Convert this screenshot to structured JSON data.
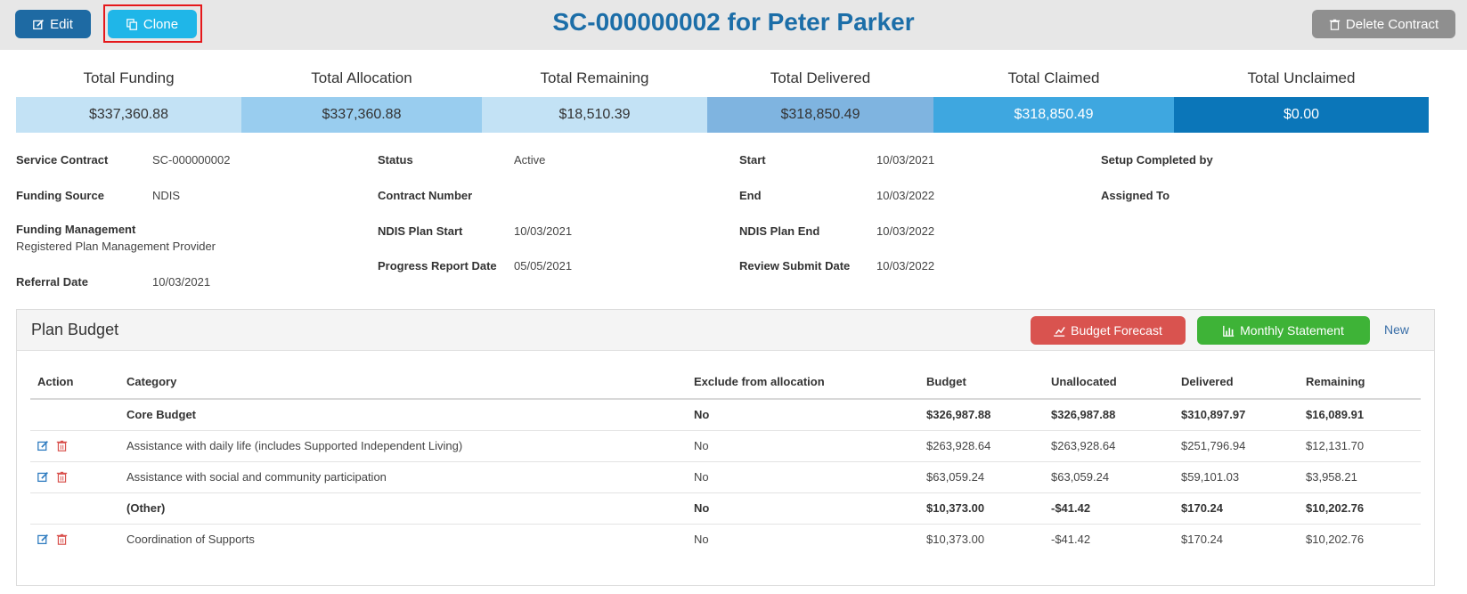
{
  "header": {
    "title": "SC-000000002 for Peter Parker",
    "edit_label": "Edit",
    "clone_label": "Clone",
    "delete_label": "Delete Contract"
  },
  "totals": {
    "labels": [
      "Total Funding",
      "Total Allocation",
      "Total Remaining",
      "Total Delivered",
      "Total Claimed",
      "Total Unclaimed"
    ],
    "values": [
      "$337,360.88",
      "$337,360.88",
      "$18,510.39",
      "$318,850.49",
      "$318,850.49",
      "$0.00"
    ],
    "colors": [
      "#c3e2f5",
      "#99cdef",
      "#c3e2f5",
      "#7fb4e0",
      "#3ea7e0",
      "#0b76b9"
    ],
    "text_colors": [
      "#333333",
      "#333333",
      "#333333",
      "#333333",
      "#ffffff",
      "#ffffff"
    ]
  },
  "details": {
    "service_contract_label": "Service Contract",
    "service_contract_value": "SC-000000002",
    "funding_source_label": "Funding Source",
    "funding_source_value": "NDIS",
    "funding_management_label": "Funding Management",
    "funding_management_value": "Registered Plan Management Provider",
    "referral_date_label": "Referral Date",
    "referral_date_value": "10/03/2021",
    "status_label": "Status",
    "status_value": "Active",
    "contract_number_label": "Contract Number",
    "ndis_plan_start_label": "NDIS Plan Start",
    "ndis_plan_start_value": "10/03/2021",
    "progress_report_label": "Progress Report Date",
    "progress_report_value": "05/05/2021",
    "start_label": "Start",
    "start_value": "10/03/2021",
    "end_label": "End",
    "end_value": "10/03/2022",
    "ndis_plan_end_label": "NDIS Plan End",
    "ndis_plan_end_value": "10/03/2022",
    "review_submit_label": "Review Submit Date",
    "review_submit_value": "10/03/2022",
    "setup_completed_label": "Setup Completed by",
    "assigned_to_label": "Assigned To"
  },
  "plan_budget": {
    "title": "Plan Budget",
    "forecast_label": "Budget Forecast",
    "monthly_label": "Monthly Statement",
    "new_label": "New",
    "columns": [
      "Action",
      "Category",
      "Exclude from allocation",
      "Budget",
      "Unallocated",
      "Delivered",
      "Remaining"
    ],
    "rows": [
      {
        "bold": true,
        "actions": false,
        "cells": [
          "Core Budget",
          "No",
          "$326,987.88",
          "$326,987.88",
          "$310,897.97",
          "$16,089.91"
        ]
      },
      {
        "bold": false,
        "actions": true,
        "cells": [
          "Assistance with daily life (includes Supported Independent Living)",
          "No",
          "$263,928.64",
          "$263,928.64",
          "$251,796.94",
          "$12,131.70"
        ]
      },
      {
        "bold": false,
        "actions": true,
        "cells": [
          "Assistance with social and community participation",
          "No",
          "$63,059.24",
          "$63,059.24",
          "$59,101.03",
          "$3,958.21"
        ]
      },
      {
        "bold": true,
        "actions": false,
        "cells": [
          "(Other)",
          "No",
          "$10,373.00",
          "-$41.42",
          "$170.24",
          "$10,202.76"
        ]
      },
      {
        "bold": false,
        "actions": true,
        "cells": [
          "Coordination of Supports",
          "No",
          "$10,373.00",
          "-$41.42",
          "$170.24",
          "$10,202.76"
        ]
      }
    ]
  }
}
